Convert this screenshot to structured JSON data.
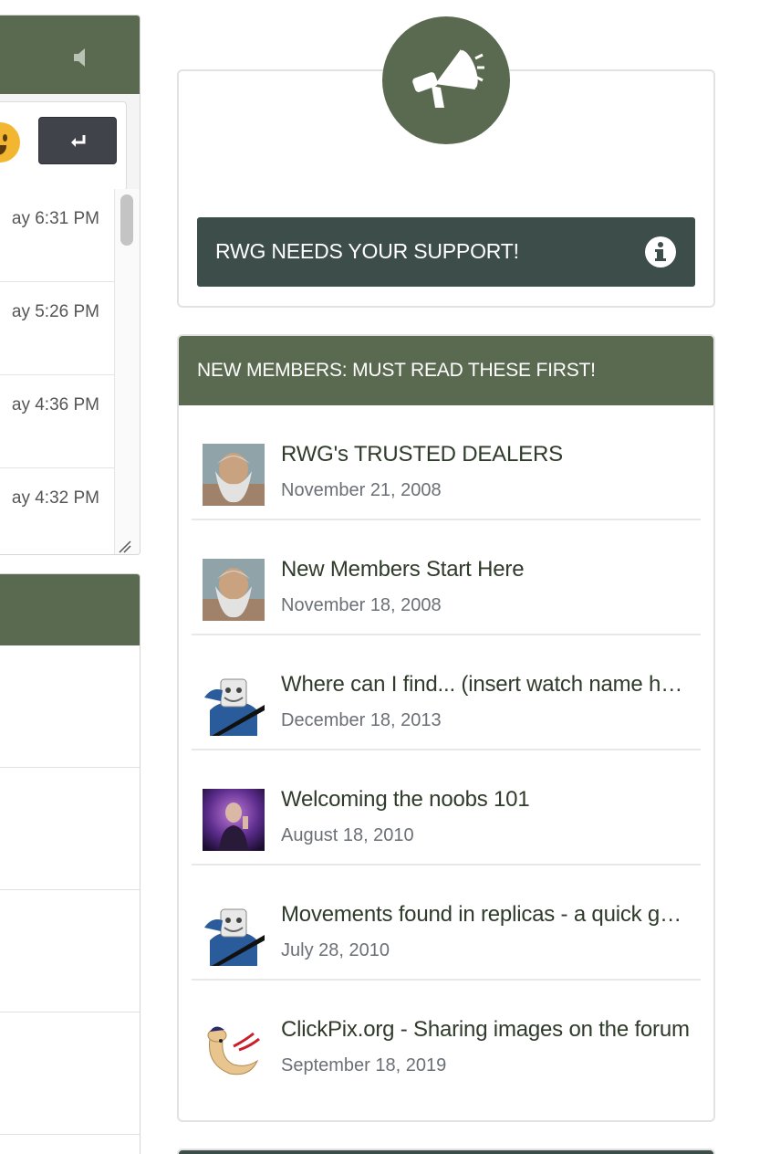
{
  "chat": {
    "timestamps": [
      "ay 6:31 PM",
      "ay 5:26 PM",
      "ay 4:36 PM",
      "ay 4:32 PM"
    ]
  },
  "support": {
    "label": "RWG NEEDS YOUR SUPPORT!"
  },
  "new_members": {
    "header": "NEW MEMBERS: MUST READ THESE FIRST!",
    "threads": [
      {
        "title": "RWG's TRUSTED DEALERS",
        "date": "November 21, 2008"
      },
      {
        "title": "New Members Start Here",
        "date": "November 18, 2008"
      },
      {
        "title": "Where can I find... (insert watch name here)",
        "date": "December 18, 2013"
      },
      {
        "title": "Welcoming the noobs 101",
        "date": "August 18, 2010"
      },
      {
        "title": "Movements found in replicas - a quick guide",
        "date": "July 28, 2010"
      },
      {
        "title": "ClickPix.org - Sharing images on the forum",
        "date": "September 18, 2019"
      }
    ]
  },
  "colors": {
    "header_green": "#5a6a50",
    "banner_slate": "#3d4d4a",
    "send_button": "#40434a"
  },
  "icons": {
    "mute": "speaker-mute-icon",
    "emoji": "smiley-emoji-icon",
    "send": "enter-return-icon",
    "megaphone": "megaphone-icon",
    "info": "info-circle-icon"
  }
}
